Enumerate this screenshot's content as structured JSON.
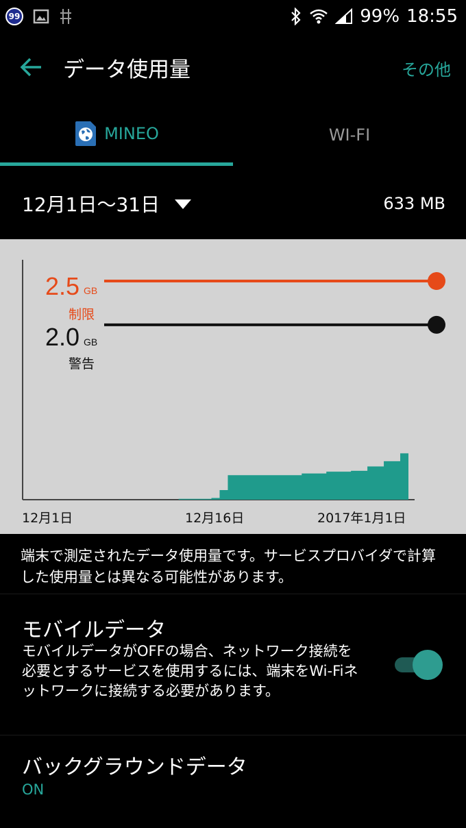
{
  "status_bar": {
    "notification_count": "99",
    "battery": "99%",
    "time": "18:55",
    "icons": [
      "gallery-icon",
      "usb-debug-icon",
      "bluetooth-icon",
      "wifi-icon",
      "signal-icon"
    ]
  },
  "app_bar": {
    "title": "データ使用量",
    "more_label": "その他"
  },
  "tabs": [
    {
      "label": "MINEO",
      "active": true,
      "icon": "sim-globe-icon"
    },
    {
      "label": "WI-FI",
      "active": false
    }
  ],
  "period": {
    "label": "12月1日〜31日",
    "total_usage": "633 MB"
  },
  "chart_data": {
    "type": "area",
    "x_ticks": [
      "12月1日",
      "12月16日",
      "2017年1月1日"
    ],
    "limit": {
      "value": "2.5",
      "unit": "GB",
      "label": "制限",
      "color": "#e64a19"
    },
    "warning": {
      "value": "2.0",
      "unit": "GB",
      "label": "警告",
      "color": "#111111"
    },
    "ylim_gb": [
      0,
      2.9
    ],
    "usage_series": [
      {
        "day": 1,
        "gb": 0
      },
      {
        "day": 16,
        "gb": 0
      },
      {
        "day": 20,
        "gb": 0.01
      },
      {
        "day": 24,
        "gb": 0.02
      },
      {
        "day": 25,
        "gb": 0.11
      },
      {
        "day": 26,
        "gb": 0.28
      },
      {
        "day": 35,
        "gb": 0.3
      },
      {
        "day": 38,
        "gb": 0.32
      },
      {
        "day": 41,
        "gb": 0.33
      },
      {
        "day": 43,
        "gb": 0.38
      },
      {
        "day": 45,
        "gb": 0.44
      },
      {
        "day": 47,
        "gb": 0.53
      },
      {
        "day": 48,
        "gb": 0.54
      }
    ],
    "fill_color": "#1f9b8c"
  },
  "description": "端末で測定されたデータ使用量です。サービスプロバイダで計算した使用量とは異なる可能性があります。",
  "mobile_data": {
    "title": "モバイルデータ",
    "description": "モバイルデータがOFFの場合、ネットワーク接続を必要とするサービスを使用するには、端末をWi-Fiネットワークに接続する必要があります。",
    "enabled": true
  },
  "background_data": {
    "title": "バックグラウンドデータ",
    "status": "ON"
  },
  "colors": {
    "accent": "#27a79b",
    "limit": "#e64a19"
  }
}
